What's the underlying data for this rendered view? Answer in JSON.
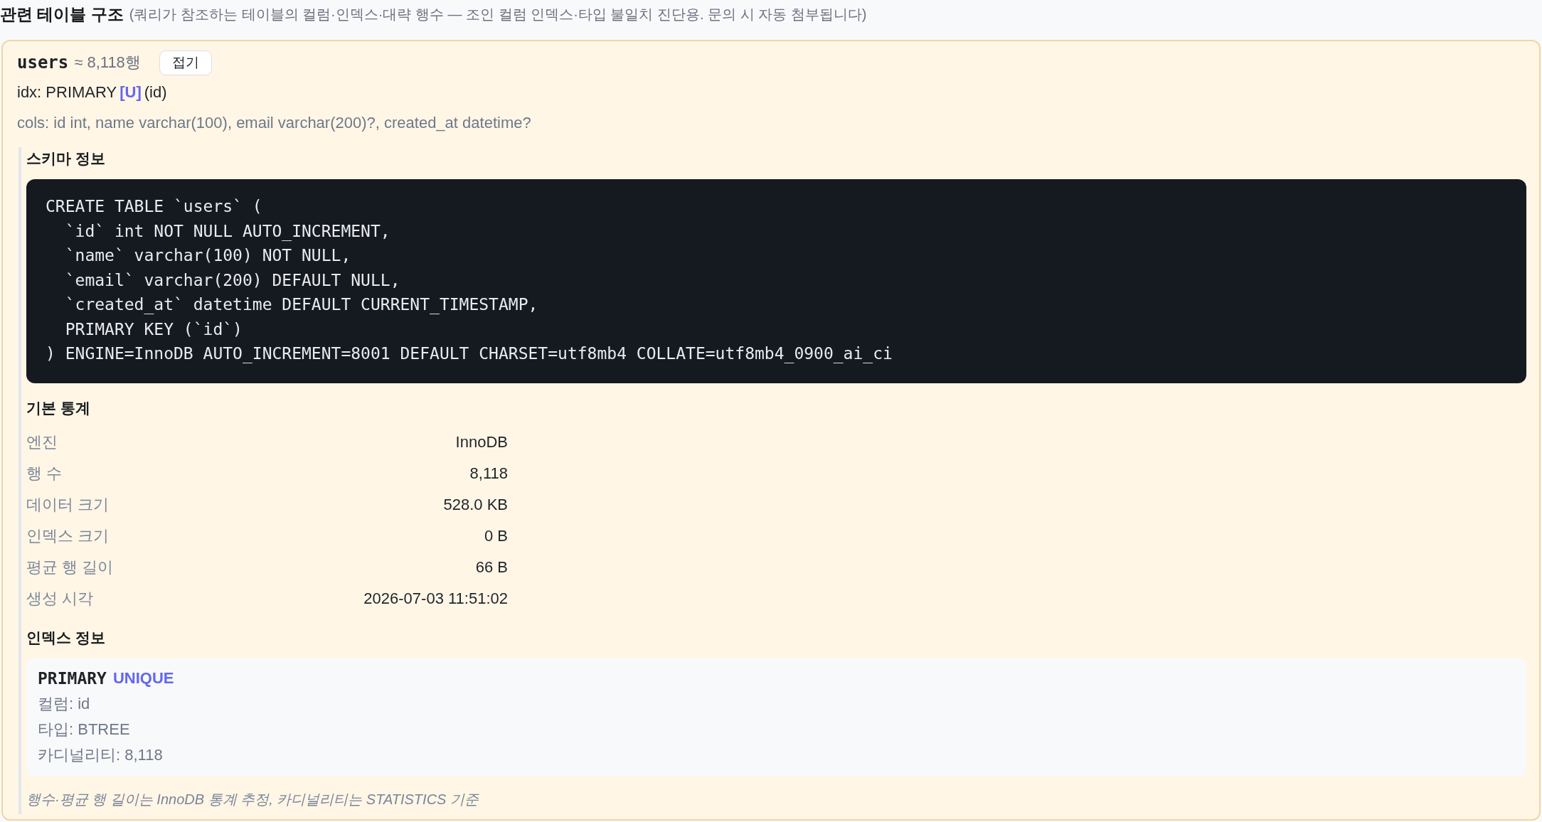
{
  "header": {
    "title": "관련 테이블 구조",
    "subtitle": "(쿼리가 참조하는 테이블의 컬럼·인덱스·대략 행수 — 조인 컬럼 인덱스·타입 불일치 진단용. 문의 시 자동 첨부됩니다)"
  },
  "tables": [
    {
      "name": "users",
      "row_estimate": "≈ 8,118행",
      "toggle_button": "접기",
      "index_summary": {
        "prefix": "idx: PRIMARY",
        "flag": "[U]",
        "columns": "(id)"
      },
      "columns_summary": "cols: id int, name varchar(100), email varchar(200)?, created_at datetime?",
      "schema": {
        "heading": "스키마 정보",
        "ddl": [
          "CREATE TABLE `users` (",
          "  `id` int NOT NULL AUTO_INCREMENT,",
          "  `name` varchar(100) NOT NULL,",
          "  `email` varchar(200) DEFAULT NULL,",
          "  `created_at` datetime DEFAULT CURRENT_TIMESTAMP,",
          "  PRIMARY KEY (`id`)",
          ") ENGINE=InnoDB AUTO_INCREMENT=8001 DEFAULT CHARSET=utf8mb4 COLLATE=utf8mb4_0900_ai_ci"
        ]
      },
      "stats": {
        "heading": "기본 통계",
        "rows": [
          {
            "label": "엔진",
            "value": "InnoDB"
          },
          {
            "label": "행 수",
            "value": "8,118"
          },
          {
            "label": "데이터 크기",
            "value": "528.0 KB"
          },
          {
            "label": "인덱스 크기",
            "value": "0 B"
          },
          {
            "label": "평균 행 길이",
            "value": "66 B"
          },
          {
            "label": "생성 시각",
            "value": "2026-07-03 11:51:02"
          }
        ]
      },
      "indexes": {
        "heading": "인덱스 정보",
        "items": [
          {
            "name": "PRIMARY",
            "badge": "UNIQUE",
            "details": [
              "컬럼: id",
              "타입: BTREE",
              "카디널리티: 8,118"
            ]
          }
        ]
      },
      "note": "행수·평균 행 길이는 InnoDB 통계 추정, 카디널리티는 STATISTICS 기준"
    }
  ]
}
